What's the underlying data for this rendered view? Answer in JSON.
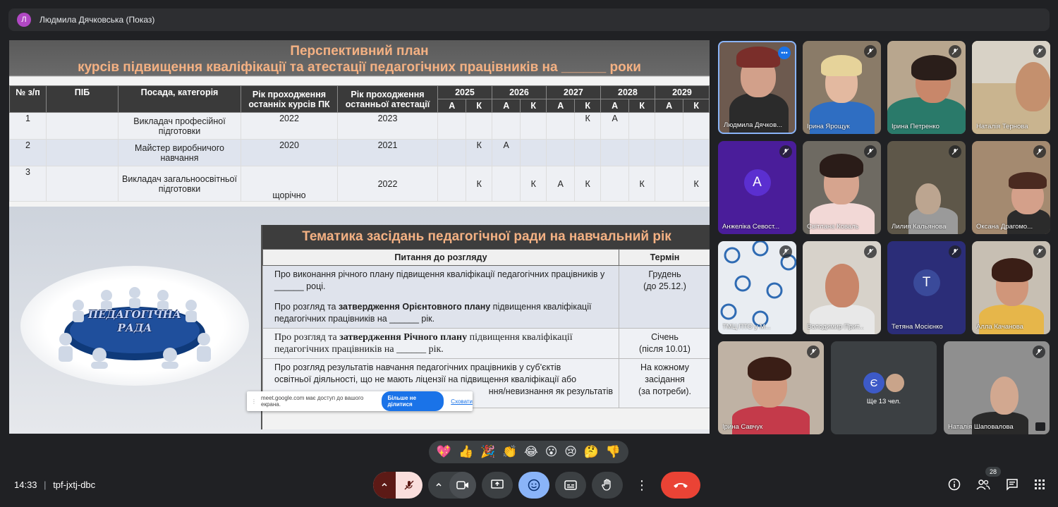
{
  "presenter": {
    "initial": "Л",
    "name": "Людмила Дячковська (Показ)"
  },
  "slide1": {
    "title_line1": "Перспективний план",
    "title_line2": "курсів підвищення кваліфікації  та атестації педагогічних працівників на ______ роки",
    "headers": [
      "№ з/п",
      "ПІБ",
      "Посада, категорія",
      "Рік  проходження останніх курсів ПК",
      "Рік  проходження останньої атестації"
    ],
    "years": [
      "2025",
      "2026",
      "2027",
      "2028",
      "2029"
    ],
    "subheads": [
      "А",
      "К"
    ],
    "rows": [
      {
        "n": "1",
        "pib": "",
        "pos": "Викладач професійної підготовки",
        "pk": "2022",
        "att": "2023",
        "cells": [
          "",
          "",
          "",
          "",
          "",
          "К",
          "А",
          "",
          "",
          ""
        ]
      },
      {
        "n": "2",
        "pib": "",
        "pos": "Майстер виробничого навчання",
        "pk": "2020",
        "att": "2021",
        "cells": [
          "",
          "К",
          "А",
          "",
          "",
          "",
          "",
          "",
          "",
          ""
        ]
      },
      {
        "n": "3",
        "pib": "",
        "pos": "Викладач загальноосвітньої підготовки",
        "pk": "щорічно",
        "att": "2022",
        "cells": [
          "",
          "К",
          "",
          "К",
          "А",
          "К",
          "",
          "К",
          "",
          "К"
        ]
      }
    ]
  },
  "slide2": {
    "title": "Тематика засідань педагогічної ради на навчальний рік",
    "col1": "Питання до розгляду",
    "col2": "Термін",
    "image_label_1": "ПЕДАГОГІЧНА",
    "image_label_2": "РАДА",
    "r1a": "Про виконання річного плану підвищення кваліфікації педагогічних працівників у ______ році.",
    "r1b_pre": "Про розгляд та ",
    "r1b_bold": "затвердження Орієнтовного плану",
    "r1b_post": " підвищення кваліфікації педагогічних працівників на ______ рік.",
    "r1_term1": "Грудень",
    "r1_term2": "(до 25.12.)",
    "r2_pre": "Про розгляд та ",
    "r2_bold": "затвердження Річного плану",
    "r2_post": " підвищення кваліфікації педагогічних працівників на ______ рік.",
    "r2_term1": "Січень",
    "r2_term2": "(після 10.01)",
    "r3_line1": "Про  розгляд  результатів  навчання  педагогічних  працівників  у  суб'єктів",
    "r3_line2": "освітньої діяльності, що не мають ліцензії на підвищення кваліфікації або",
    "r3_line3": "ння/невизнання як результатів",
    "r3_term1": "На кожному",
    "r3_term2": "засідання",
    "r3_term3": "(за потреби)."
  },
  "toast": {
    "text": "meet.google.com має доступ до вашого екрана.",
    "stop": "Більше не ділитися",
    "hide": "Сховати"
  },
  "participants": [
    {
      "name": "Людмила Дячков...",
      "speaking": true
    },
    {
      "name": "Ірина Ярощук"
    },
    {
      "name": "Ірина Петренко"
    },
    {
      "name": "Наталія Тернова"
    },
    {
      "name": "Анжеліка Севост...",
      "initial": "А"
    },
    {
      "name": "Світлана Коваль"
    },
    {
      "name": "Лилия Кальянова"
    },
    {
      "name": "Оксана Драгомо..."
    },
    {
      "name": "ТМЦ ПТО у М..."
    },
    {
      "name": "Володимир Прит..."
    },
    {
      "name": "Тетяна Мосієнко",
      "initial": "Т"
    },
    {
      "name": "Алла Качанова"
    },
    {
      "name": "Ірина Савчук"
    },
    {
      "name": "Ще 13 чел.",
      "initial": "Є"
    },
    {
      "name": "Наталія Шаповалова"
    }
  ],
  "reactions": [
    "💖",
    "👍",
    "🎉",
    "👏",
    "😂",
    "😮",
    "😢",
    "🤔",
    "👎"
  ],
  "meeting": {
    "time": "14:33",
    "code": "tpf-jxtj-dbc",
    "people_count": "28"
  },
  "colors": {
    "end_call": "#ea4335",
    "mic_off": "#f9dedc",
    "emoji_active": "#8ab4f8"
  }
}
